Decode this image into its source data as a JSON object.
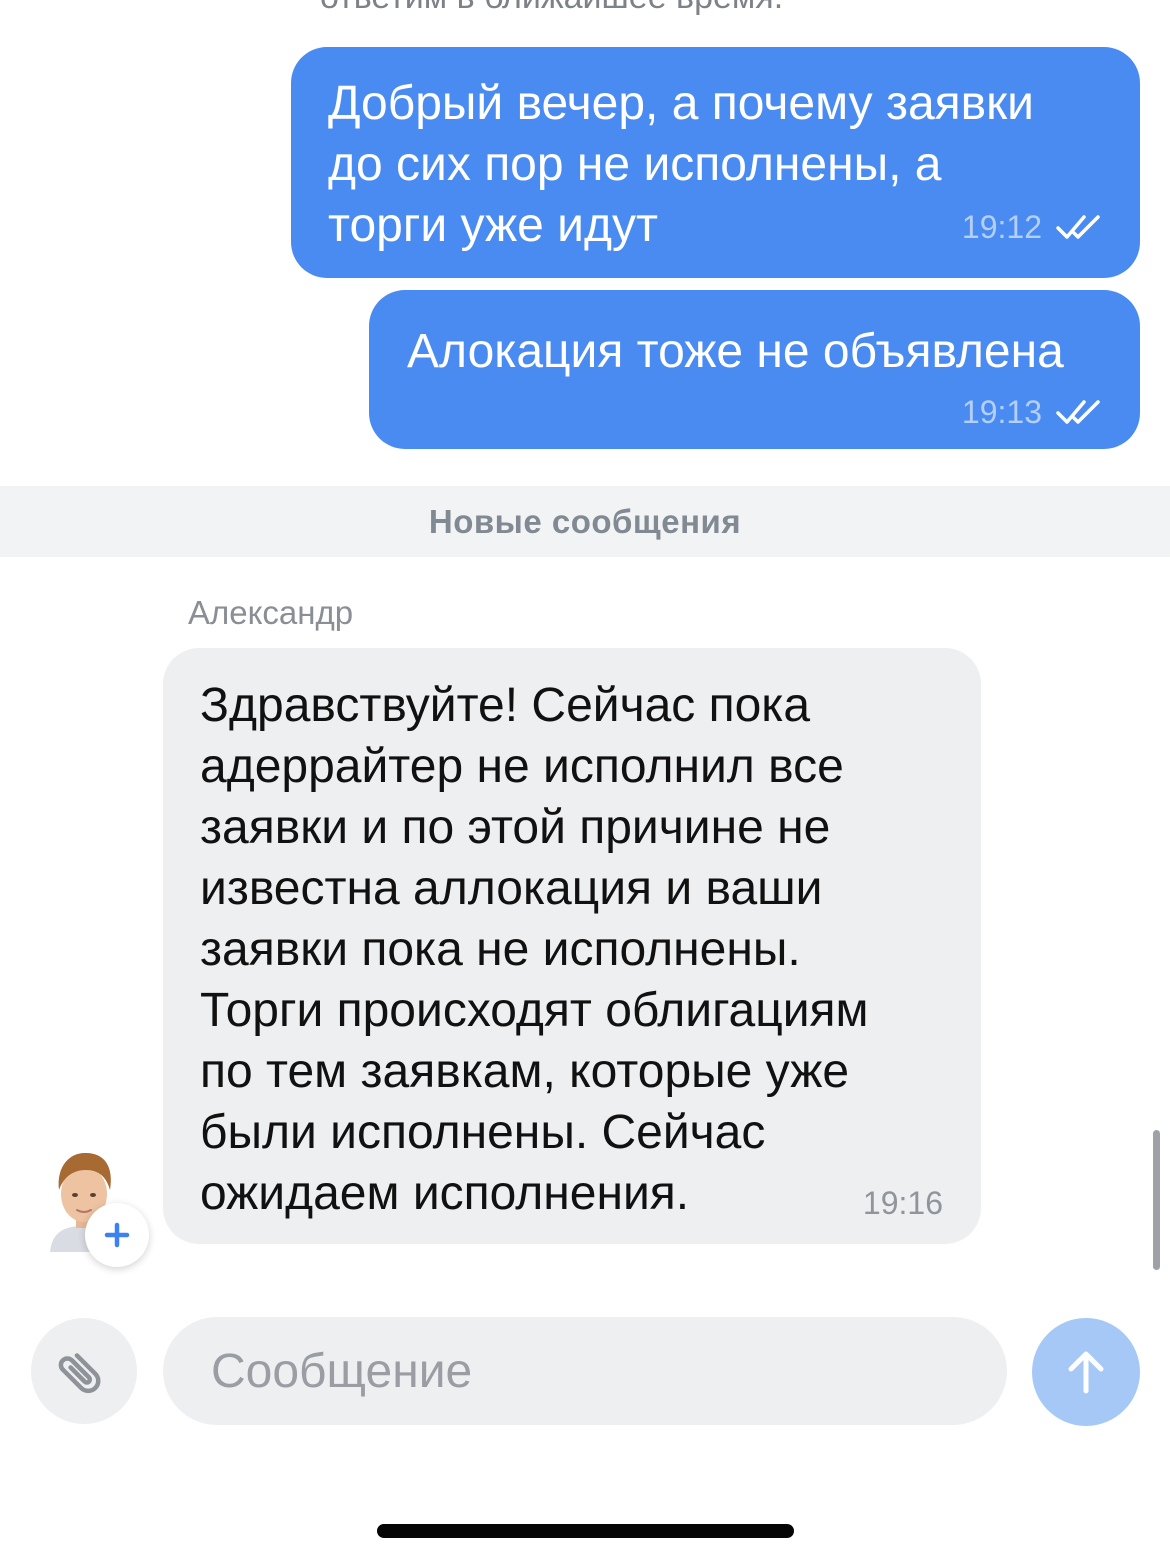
{
  "chat": {
    "cut_off_text": "ответим в ближайшее время.",
    "outgoing": [
      {
        "lines": [
          "Добрый вечер, а почему заявки",
          "до сих пор не исполнены, а",
          "торги уже идут"
        ],
        "time": "19:12"
      },
      {
        "lines": [
          "Алокация тоже не объявлена"
        ],
        "time": "19:13"
      }
    ],
    "new_messages_divider": "Новые сообщения",
    "incoming": {
      "sender": "Александр",
      "lines": [
        "Здравствуйте! Сейчас пока",
        "адеррайтер не исполнил все",
        "заявки и по этой причине не",
        "известна аллокация и ваши",
        "заявки пока не исполнены.",
        "Торги происходят облигациям",
        "по тем заявкам, которые уже",
        "были исполнены. Сейчас",
        "ожидаем исполнения."
      ],
      "time": "19:16"
    }
  },
  "composer": {
    "placeholder": "Сообщение",
    "value": ""
  },
  "icons": {
    "attach": "paperclip-icon",
    "send": "arrow-up-icon",
    "read_status": "double-check-icon",
    "avatar_badge": "plus-icon"
  },
  "colors": {
    "outgoing_bubble": "#4a8bf2",
    "incoming_bubble": "#eeeff1",
    "send_button": "#a6c8f7",
    "divider_background": "#f2f3f5"
  }
}
